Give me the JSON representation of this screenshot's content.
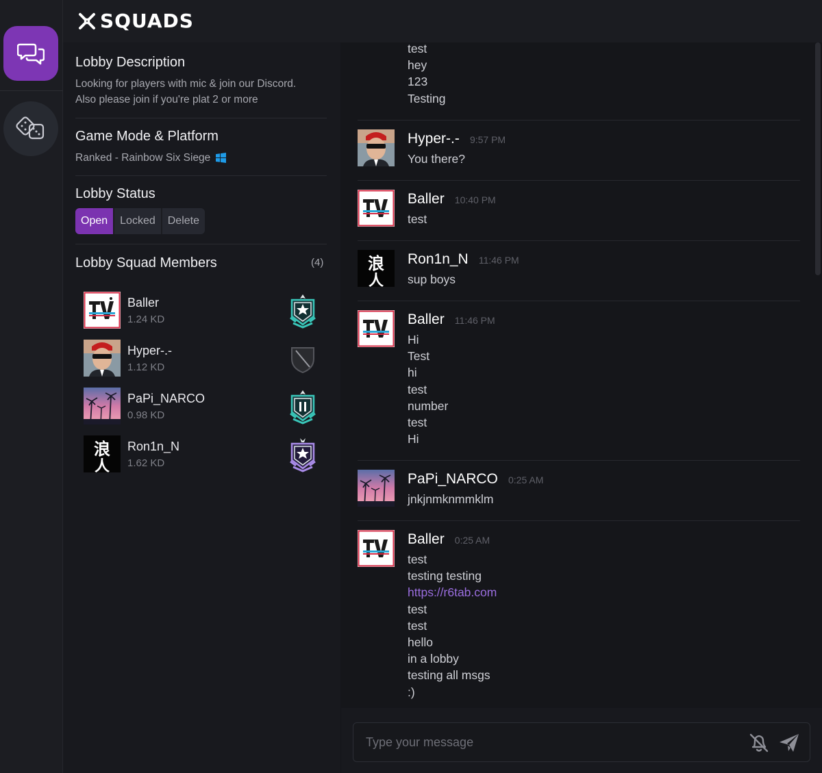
{
  "app": {
    "name": "SQUADS"
  },
  "rail": {
    "chat_icon": "chat-bubbles-icon",
    "games_icon": "dice-icon"
  },
  "lobby": {
    "description_title": "Lobby Description",
    "description_line1": "Looking for players with mic & join our Discord.",
    "description_line2": "Also please join if you're plat 2 or more",
    "mode_title": "Game Mode & Platform",
    "mode_value": "Ranked - Rainbow Six Siege",
    "platform_icon": "windows-icon",
    "status_title": "Lobby Status",
    "status_options": [
      "Open",
      "Locked",
      "Delete"
    ],
    "status_selected": "Open",
    "members_title": "Lobby Squad Members",
    "members_count": "(4)",
    "members": [
      {
        "name": "Baller",
        "kd": "1.24 KD",
        "rank_icon": "teal-star-rank-icon"
      },
      {
        "name": "Hyper-.-",
        "kd": "1.12 KD",
        "rank_icon": "unranked-shield-icon"
      },
      {
        "name": "PaPi_NARCO",
        "kd": "0.98 KD",
        "rank_icon": "teal-star-rank-icon"
      },
      {
        "name": "Ron1n_N",
        "kd": "1.62 KD",
        "rank_icon": "purple-diamond-rank-icon"
      }
    ]
  },
  "chat": {
    "messages": [
      {
        "user": "",
        "time": "",
        "lines": [
          "test",
          "hey",
          "123",
          "Testing"
        ]
      },
      {
        "user": "Hyper-.-",
        "time": "9:57 PM",
        "lines": [
          "You there?"
        ]
      },
      {
        "user": "Baller",
        "time": "10:40 PM",
        "lines": [
          "test"
        ]
      },
      {
        "user": "Ron1n_N",
        "time": "11:46 PM",
        "lines": [
          "sup boys"
        ]
      },
      {
        "user": "Baller",
        "time": "11:46 PM",
        "lines": [
          "Hi",
          "Test",
          "hi",
          "test",
          "number",
          "test",
          "Hi"
        ]
      },
      {
        "user": "PaPi_NARCO",
        "time": "0:25 AM",
        "lines": [
          "jnkjnmknmmklm"
        ]
      },
      {
        "user": "Baller",
        "time": "0:25 AM",
        "lines": [
          "test",
          "testing testing",
          "https://r6tab.com",
          "test",
          "test",
          "hello",
          "in a lobby",
          "testing all msgs",
          ":)"
        ]
      }
    ],
    "input_placeholder": "Type your message",
    "mute_icon": "bell-off-icon",
    "send_icon": "send-icon"
  },
  "colors": {
    "accent": "#7d36b4",
    "link": "#9b6ee0",
    "windows": "#1e9be8"
  }
}
